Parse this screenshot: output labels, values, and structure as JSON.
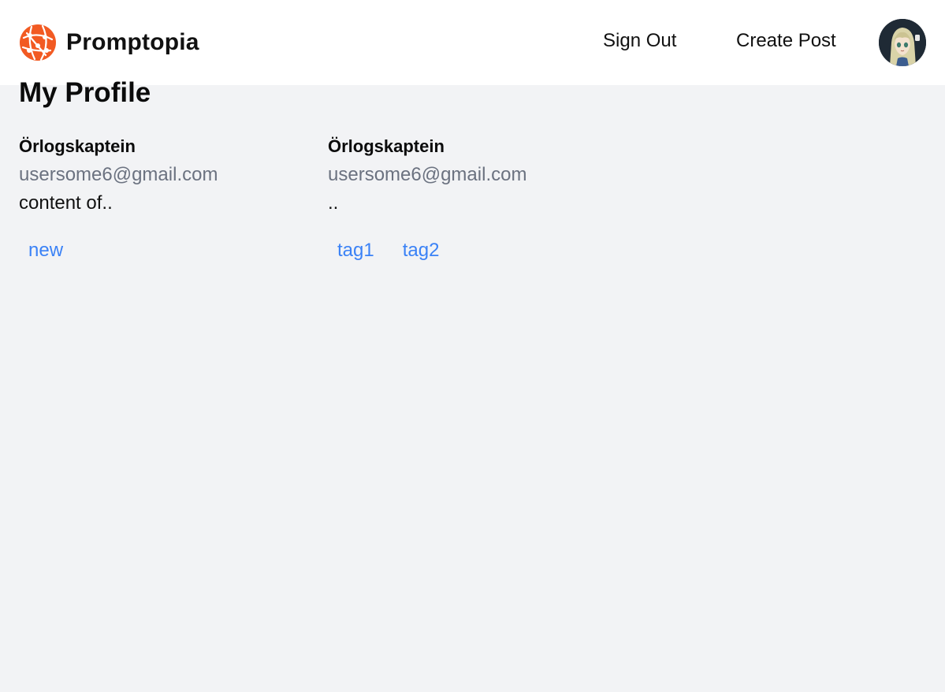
{
  "header": {
    "brand_name": "Promptopia",
    "logo_icon": "globe-network-icon",
    "brand_color": "#f25a22",
    "sign_out_label": "Sign Out",
    "create_post_label": "Create Post",
    "avatar_icon": "user-avatar-image"
  },
  "page": {
    "title": "My Profile"
  },
  "posts": [
    {
      "username": "Örlogskaptein",
      "email": "usersome6@gmail.com",
      "content": "content of..",
      "tags": [
        "new"
      ]
    },
    {
      "username": "Örlogskaptein",
      "email": "usersome6@gmail.com",
      "content": "..",
      "tags": [
        "tag1",
        "tag2"
      ]
    }
  ],
  "colors": {
    "tag": "#3b82f6",
    "email": "#6b7280",
    "background": "#f2f3f5"
  }
}
